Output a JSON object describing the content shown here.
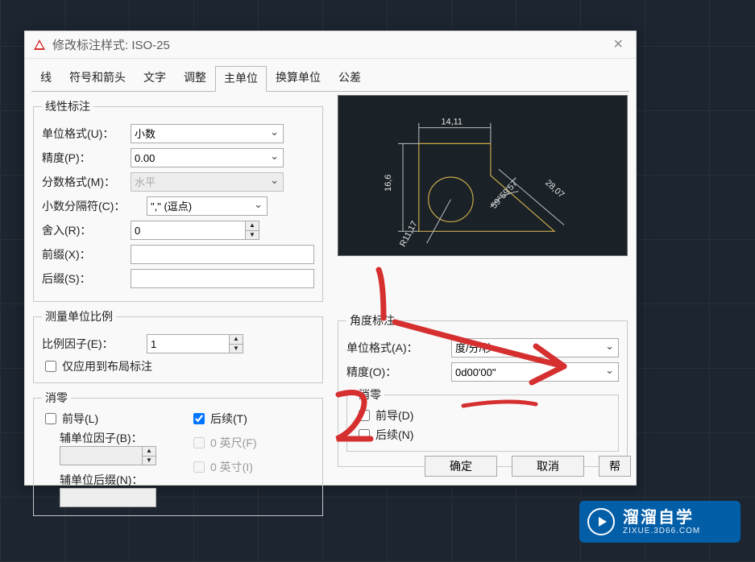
{
  "window": {
    "title": "修改标注样式: ISO-25"
  },
  "tabs": {
    "items": [
      "线",
      "符号和箭头",
      "文字",
      "调整",
      "主单位",
      "换算单位",
      "公差"
    ],
    "active_index": 4
  },
  "linear": {
    "legend": "线性标注",
    "unit_format_label": "单位格式(U)：",
    "unit_format_value": "小数",
    "precision_label": "精度(P)：",
    "precision_value": "0.00",
    "fraction_label": "分数格式(M)：",
    "fraction_value": "水平",
    "decimal_sep_label": "小数分隔符(C)：",
    "decimal_sep_value": "\",\" (逗点)",
    "round_label": "舍入(R)：",
    "round_value": "0",
    "prefix_label": "前缀(X)：",
    "prefix_value": "",
    "suffix_label": "后缀(S)：",
    "suffix_value": ""
  },
  "measure_scale": {
    "legend": "测量单位比例",
    "scale_factor_label": "比例因子(E)：",
    "scale_factor_value": "1",
    "layout_only_label": "仅应用到布局标注"
  },
  "zero_suppress": {
    "legend": "消零",
    "leading_label": "前导(L)",
    "trailing_label": "后续(T)",
    "trailing_checked": true,
    "sub_factor_label": "辅单位因子(B)：",
    "sub_factor_value": "",
    "sub_suffix_label": "辅单位后缀(N)：",
    "sub_suffix_value": "",
    "feet_label": "0 英尺(F)",
    "inches_label": "0 英寸(I)"
  },
  "preview": {
    "dim_top": "14,11",
    "dim_left": "16,6",
    "dim_diag": "28,07",
    "dim_angle": "59°59'57\"",
    "dim_radius": "R11,17"
  },
  "angular": {
    "legend": "角度标注",
    "unit_format_label": "单位格式(A)：",
    "unit_format_value": "度/分/秒",
    "precision_label": "精度(O)：",
    "precision_value": "0d00'00\"",
    "zero_legend": "消零",
    "leading_label": "前导(D)",
    "trailing_label": "后续(N)"
  },
  "footer": {
    "ok": "确定",
    "cancel": "取消",
    "help": "帮"
  },
  "badge": {
    "title": "溜溜自学",
    "subtitle": "ZIXUE.3D66.COM"
  },
  "annotation": {
    "num1": "1",
    "num2": "2"
  }
}
